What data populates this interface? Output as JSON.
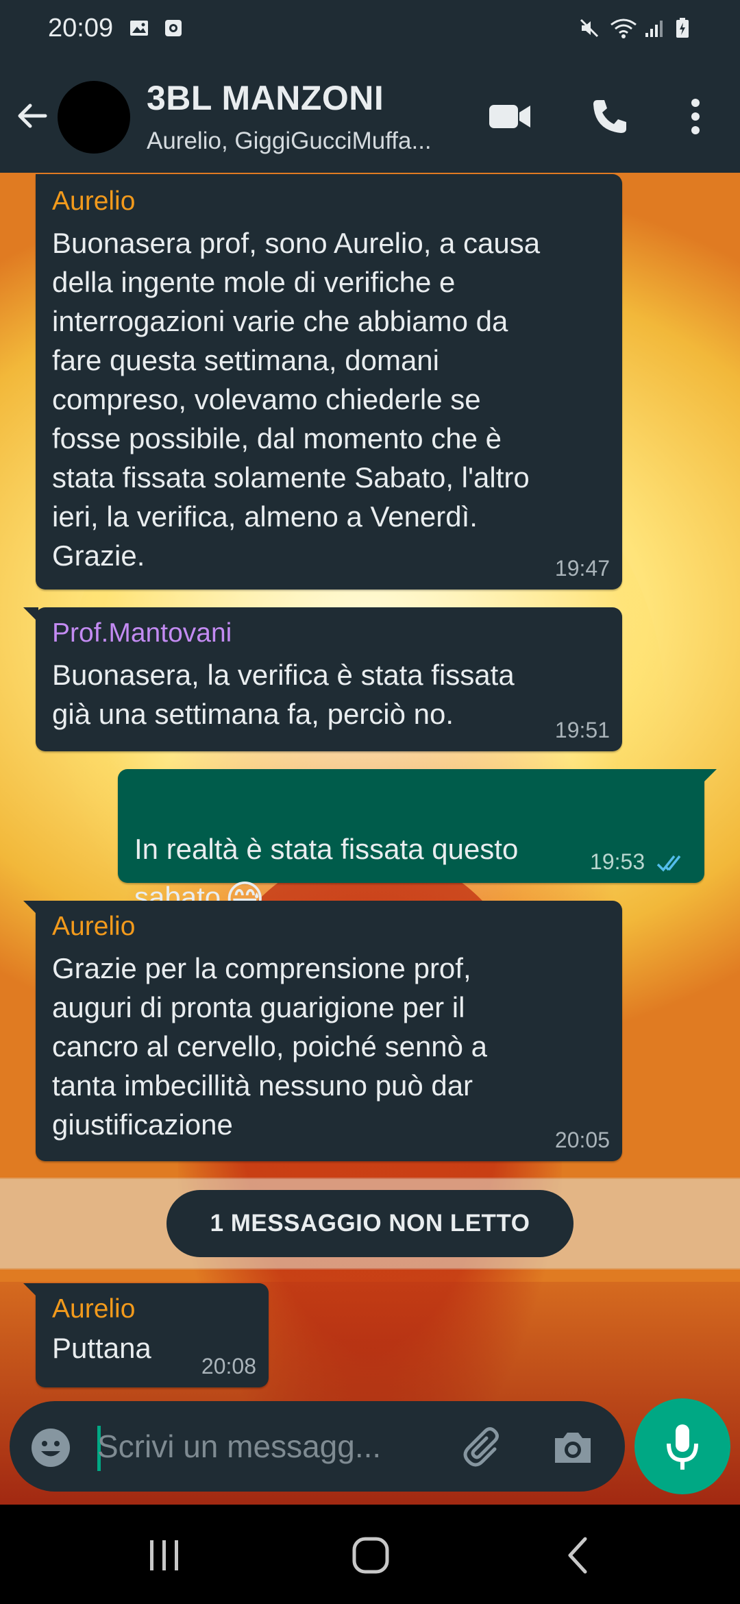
{
  "status_bar": {
    "time": "20:09"
  },
  "header": {
    "group_name": "3BL MANZONI",
    "members": "Aurelio, GiggiGucciMuffa..."
  },
  "messages": [
    {
      "direction": "incoming",
      "sender": "Aurelio",
      "sender_color": "#f29a1c",
      "text": "Buonasera prof, sono Aurelio, a causa\ndella ingente mole di verifiche e\ninterrogazioni varie che abbiamo da\nfare questa settimana, domani\ncompreso, volevamo chiederle se\nfosse possibile, dal momento che è\nstata fissata solamente Sabato, l'altro\nieri, la verifica, almeno a Venerdì.\nGrazie.",
      "time": "19:47"
    },
    {
      "direction": "incoming",
      "sender": "Prof.Mantovani",
      "sender_color": "#c38bf2",
      "text": "Buonasera, la verifica è stata fissata\ngià una settimana fa, perciò no.",
      "time": "19:51"
    },
    {
      "direction": "outgoing",
      "text": "In realtà è stata fissata questo\nsabato",
      "emoji": "😅",
      "time": "19:53",
      "status": "read"
    },
    {
      "direction": "incoming",
      "sender": "Aurelio",
      "sender_color": "#f29a1c",
      "text": "Grazie per la comprensione prof,\nauguri di pronta guarigione per il\ncancro al cervello, poiché sennò a\ntanta imbecillità nessuno può dar\ngiustificazione",
      "time": "20:05"
    },
    {
      "direction": "incoming",
      "sender": "Aurelio",
      "sender_color": "#f29a1c",
      "text": "Puttana",
      "time": "20:08"
    }
  ],
  "unread_label": "1 MESSAGGIO NON LETTO",
  "composer": {
    "placeholder": "Scrivi un messagg..."
  },
  "icons": {
    "back": "arrow-left-icon",
    "video": "video-camera-icon",
    "call": "phone-icon",
    "menu": "more-vertical-icon",
    "emoji": "emoji-icon",
    "attach": "paperclip-icon",
    "camera": "camera-icon",
    "mic": "microphone-icon"
  },
  "colors": {
    "bar_bg": "#1f2c34",
    "incoming_bubble": "#1f2c34",
    "outgoing_bubble": "#005c4b",
    "accent": "#00a884",
    "read_ticks": "#53bdeb"
  }
}
